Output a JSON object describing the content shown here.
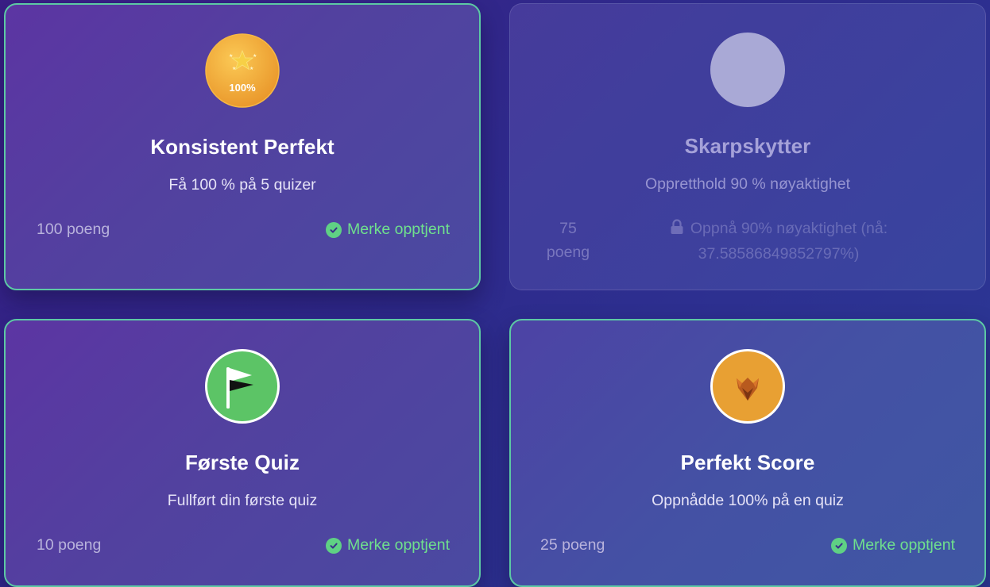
{
  "badges": [
    {
      "icon": "gold-medal-100-icon",
      "icon_text": "100%",
      "title": "Konsistent Perfekt",
      "description": "Få 100 % på 5 quizer",
      "points": "100 poeng",
      "status": "Merke opptjent"
    },
    {
      "icon": "locked-placeholder-icon",
      "title": "Skarpskytter",
      "description": "Oppretthold 90 % nøyaktighet",
      "points_line1": "75",
      "points_line2": "poeng",
      "requirement_line1": "Oppnå 90% nøyaktighet (nå:",
      "requirement_line2": "37.58586849852797%)"
    },
    {
      "icon": "flag-icon",
      "title": "Første Quiz",
      "description": "Fullført din første quiz",
      "points": "10 poeng",
      "status": "Merke opptjent"
    },
    {
      "icon": "fox-icon",
      "title": "Perfekt Score",
      "description": "Oppnådde 100% på en quiz",
      "points": "25 poeng",
      "status": "Merke opptjent"
    }
  ],
  "colors": {
    "earned_border": "#5cc9a4",
    "earned_status": "#6fe08d",
    "medal_gold": "#f0a830",
    "flag_bg": "#5cc466",
    "fox_bg": "#e8a033"
  }
}
